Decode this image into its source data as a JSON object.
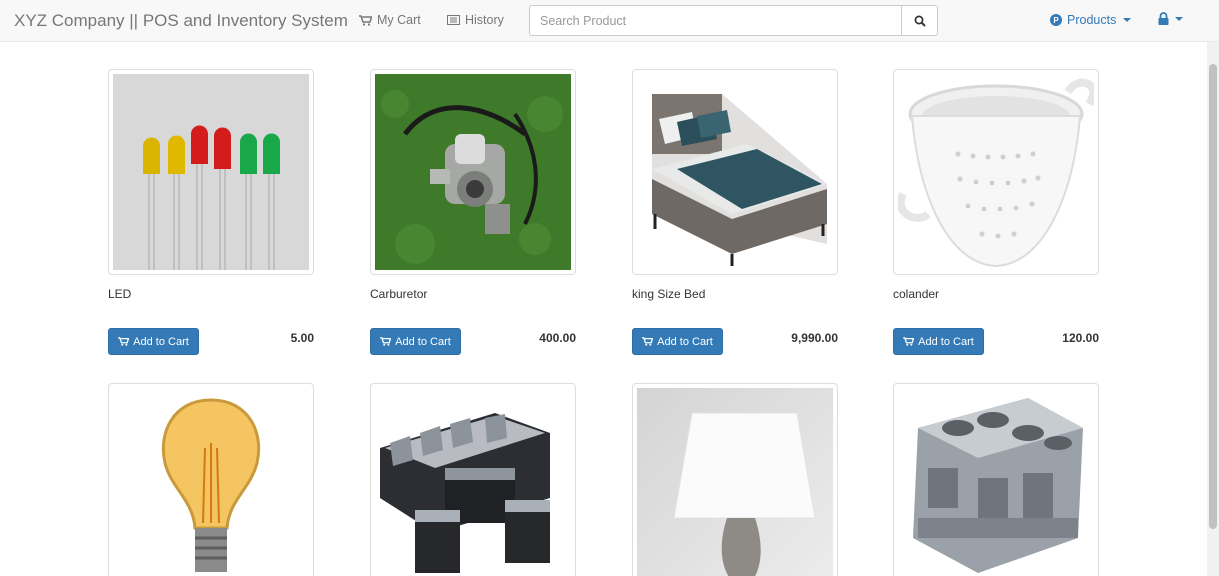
{
  "navbar": {
    "brand": "XYZ Company || POS and Inventory System",
    "my_cart": "My Cart",
    "history": "History",
    "search_placeholder": "Search Product",
    "products": "Products"
  },
  "colors": {
    "primary": "#337ab7",
    "navbar_bg": "#f8f8f8",
    "muted_text": "#777777"
  },
  "products": [
    {
      "name": "LED",
      "price": "5.00",
      "button": "Add to Cart",
      "image": "led-lights"
    },
    {
      "name": "Carburetor",
      "price": "400.00",
      "button": "Add to Cart",
      "image": "carburetor"
    },
    {
      "name": "king Size Bed",
      "price": "9,990.00",
      "button": "Add to Cart",
      "image": "bed"
    },
    {
      "name": "colander",
      "price": "120.00",
      "button": "Add to Cart",
      "image": "colander"
    },
    {
      "image": "light-bulb"
    },
    {
      "image": "sofa-set"
    },
    {
      "image": "table-lamp"
    },
    {
      "image": "engine-block"
    }
  ]
}
